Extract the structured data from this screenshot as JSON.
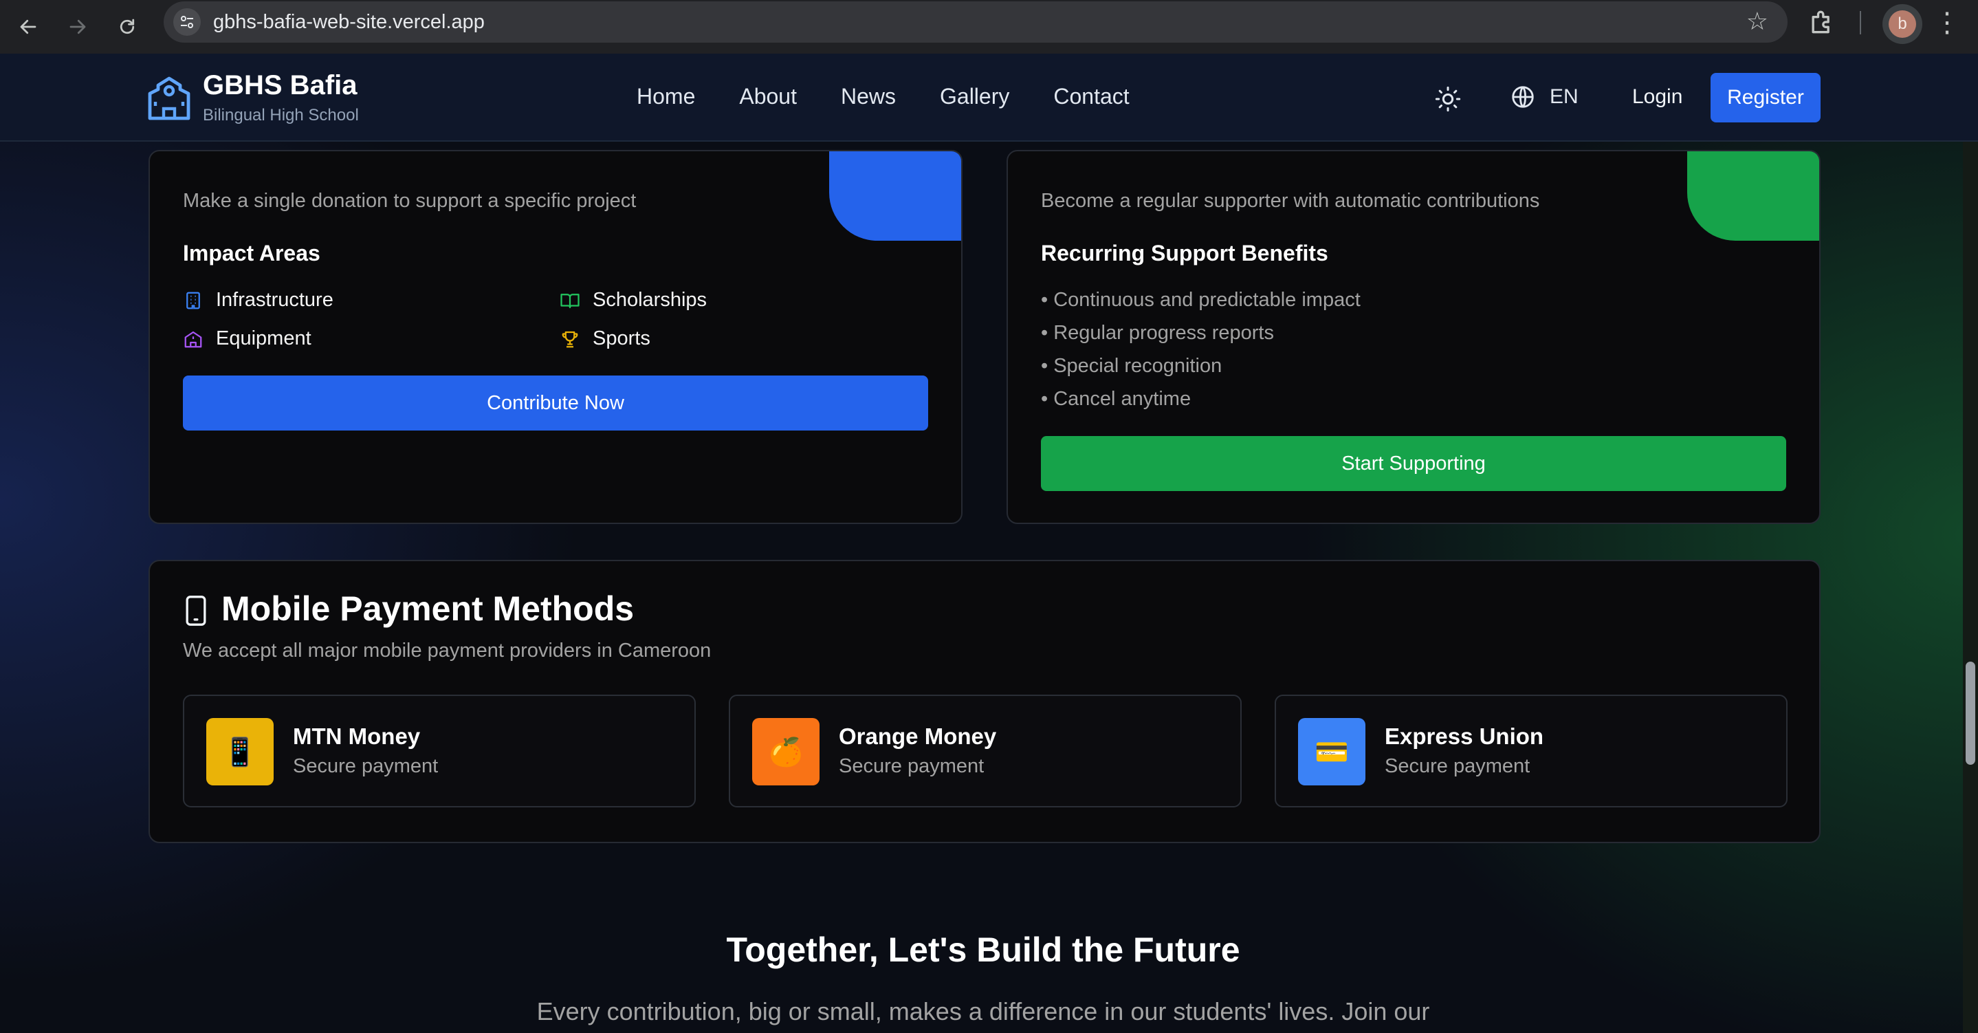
{
  "browser": {
    "url": "gbhs-bafia-web-site.vercel.app",
    "profile_initial": "b"
  },
  "header": {
    "brand_title": "GBHS Bafia",
    "brand_subtitle": "Bilingual High School",
    "nav": [
      "Home",
      "About",
      "News",
      "Gallery",
      "Contact"
    ],
    "language": "EN",
    "login": "Login",
    "register": "Register"
  },
  "one_time": {
    "description": "Make a single donation to support a specific project",
    "impact_title": "Impact Areas",
    "impact_items": [
      "Infrastructure",
      "Scholarships",
      "Equipment",
      "Sports"
    ],
    "button": "Contribute Now"
  },
  "recurring": {
    "description": "Become a regular supporter with automatic contributions",
    "benefits_title": "Recurring Support Benefits",
    "benefits": [
      "• Continuous and predictable impact",
      "• Regular progress reports",
      "• Special recognition",
      "• Cancel anytime"
    ],
    "button": "Start Supporting"
  },
  "payments": {
    "title": "Mobile Payment Methods",
    "subtitle": "We accept all major mobile payment providers in Cameroon",
    "methods": [
      {
        "name": "MTN Money",
        "note": "Secure payment",
        "glyph": "📱",
        "color": "#eab308"
      },
      {
        "name": "Orange Money",
        "note": "Secure payment",
        "glyph": "🍊",
        "color": "#f97316"
      },
      {
        "name": "Express Union",
        "note": "Secure payment",
        "glyph": "💳",
        "color": "#3b82f6"
      }
    ]
  },
  "closing": {
    "title": "Together, Let's Build the Future",
    "text": "Every contribution, big or small, makes a difference in our students' lives. Join our"
  },
  "colors": {
    "primary_blue": "#2563eb",
    "primary_green": "#16a34a",
    "header_bg": "#0f172a"
  }
}
